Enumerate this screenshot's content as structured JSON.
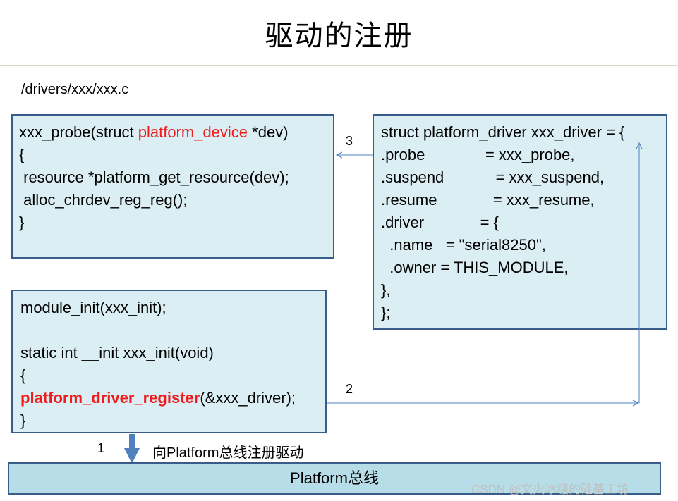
{
  "title": "驱动的注册",
  "file_path": "/drivers/xxx/xxx.c",
  "probe_box": {
    "line1_pre": "xxx_probe(struct ",
    "line1_red": "platform_device",
    "line1_post": " *dev)",
    "line2": "{",
    "line3": " resource *platform_get_resource(dev);",
    "line4": " alloc_chrdev_reg_reg();",
    "line5": "}"
  },
  "driver_box": {
    "lines": [
      "struct platform_driver xxx_driver = {",
      ".probe              = xxx_probe,",
      ".suspend            = xxx_suspend,",
      ".resume             = xxx_resume,",
      ".driver             = {",
      "  .name   = \"serial8250\",",
      "  .owner = THIS_MODULE,",
      "},",
      "};"
    ]
  },
  "init_box": {
    "line1": "module_init(xxx_init);",
    "line2": "",
    "line3": "static int __init xxx_init(void)",
    "line4": "{",
    "line5_red": "platform_driver_register",
    "line5_post": "(&xxx_driver);",
    "line6": "}"
  },
  "arrows": {
    "step1": "1",
    "step2": "2",
    "step3": "3",
    "register_label": "向Platform总线注册驱动"
  },
  "bus": {
    "label": "Platform总线"
  },
  "watermark": "CSDN @文火冰糖的硅基工坊",
  "colors": {
    "box_fill": "#dbeef4",
    "bus_fill": "#b7dde8",
    "border": "#385d8a",
    "highlight": "#ee1c1c",
    "arrow": "#4f81bd"
  }
}
